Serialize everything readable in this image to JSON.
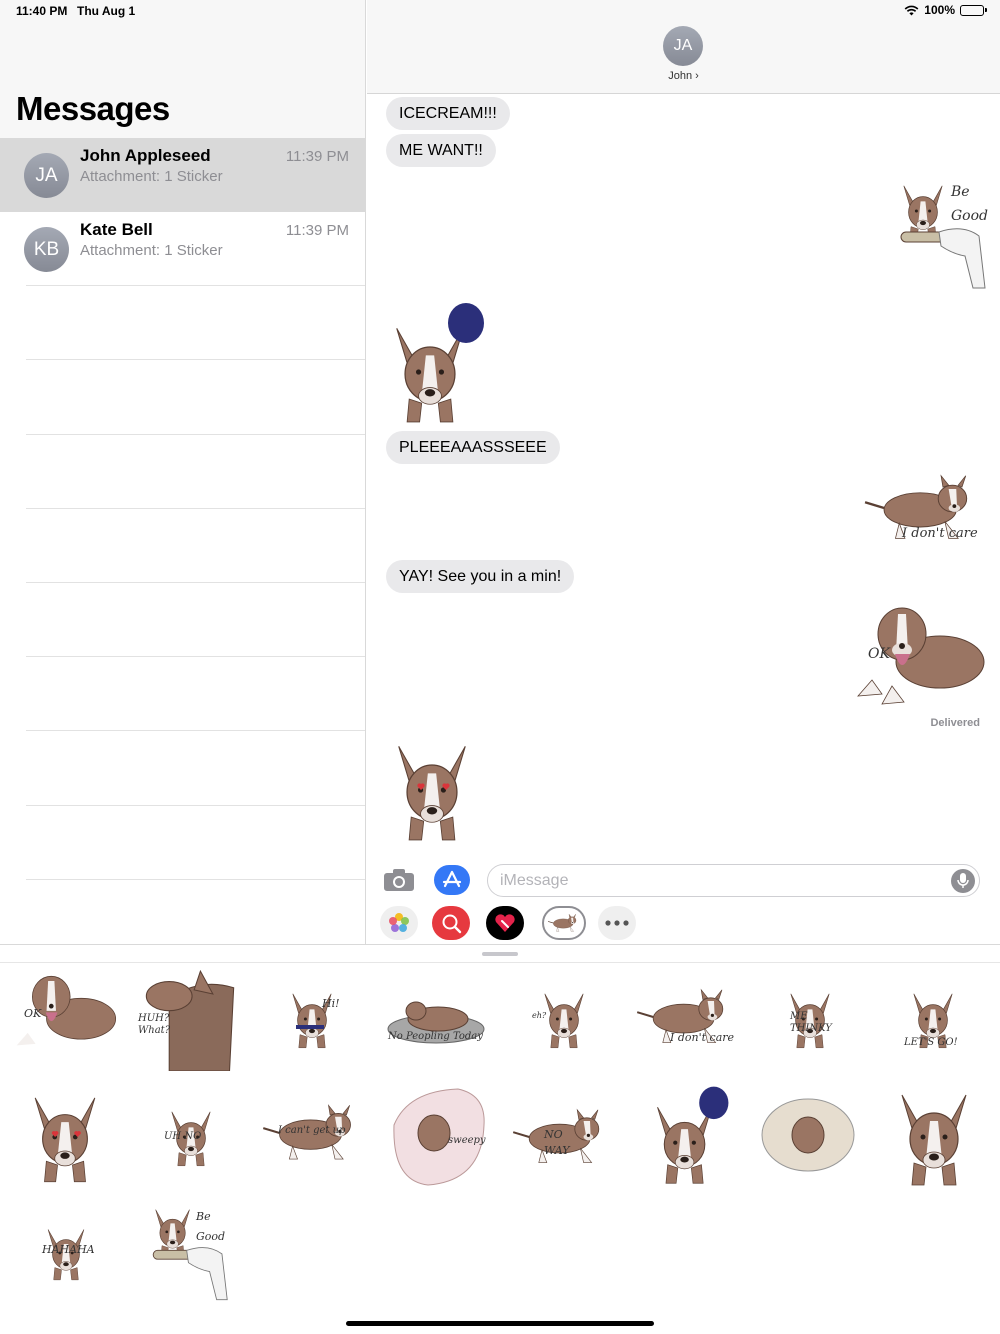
{
  "status_bar": {
    "time": "11:40 PM",
    "date": "Thu Aug 1",
    "battery": "100%"
  },
  "sidebar": {
    "title": "Messages",
    "conversations": [
      {
        "initials": "JA",
        "name": "John Appleseed",
        "preview": "Attachment: 1 Sticker",
        "time": "11:39 PM",
        "selected": true
      },
      {
        "initials": "KB",
        "name": "Kate Bell",
        "preview": "Attachment: 1 Sticker",
        "time": "11:39 PM",
        "selected": false
      }
    ]
  },
  "chat": {
    "contact_initials": "JA",
    "contact_name": "John ›",
    "messages": [
      {
        "type": "text",
        "from": "them",
        "text": "ICECREAM!!!"
      },
      {
        "type": "text",
        "from": "them",
        "text": "ME WANT!!"
      },
      {
        "type": "sticker",
        "from": "me",
        "caption": "Be Good",
        "icon": "dog-bone-sticker"
      },
      {
        "type": "sticker",
        "from": "them",
        "caption": "",
        "icon": "dog-head-hat-sticker"
      },
      {
        "type": "text",
        "from": "them",
        "text": "PLEEEAAASSSEEE"
      },
      {
        "type": "sticker",
        "from": "me",
        "caption": "I don't care",
        "icon": "dog-lying-sticker"
      },
      {
        "type": "text",
        "from": "them",
        "text": "YAY! See you in a min!"
      },
      {
        "type": "sticker",
        "from": "me",
        "caption": "OK",
        "icon": "dog-ok-sticker"
      },
      {
        "type": "sticker",
        "from": "them",
        "caption": "",
        "icon": "dog-hearts-sticker"
      }
    ],
    "delivered_label": "Delivered"
  },
  "compose": {
    "placeholder": "iMessage"
  },
  "app_strip": [
    "photos-icon",
    "image-search-icon",
    "digital-touch-icon",
    "dog-sticker-app-icon",
    "more-icon"
  ],
  "sticker_drawer": {
    "stickers": [
      {
        "caption": "OK"
      },
      {
        "caption": "HUH? What?"
      },
      {
        "caption": "Hi!"
      },
      {
        "caption": "No Peopling Today"
      },
      {
        "caption": "eh?"
      },
      {
        "caption": "I don't care"
      },
      {
        "caption": "ME THINKY"
      },
      {
        "caption": "LET'S GO!"
      },
      {
        "caption": ""
      },
      {
        "caption": "UH NO"
      },
      {
        "caption": "I can't get up"
      },
      {
        "caption": "sweepy"
      },
      {
        "caption": "NO WAY"
      },
      {
        "caption": ""
      },
      {
        "caption": ""
      },
      {
        "caption": ""
      },
      {
        "caption": "HAHAHA"
      },
      {
        "caption": "Be Good"
      }
    ]
  },
  "colors": {
    "dog_brown": "#9a7563",
    "bubble_gray": "#e9e9eb",
    "accent_blue": "#3478f6",
    "selected_row": "#d9d9d9"
  }
}
